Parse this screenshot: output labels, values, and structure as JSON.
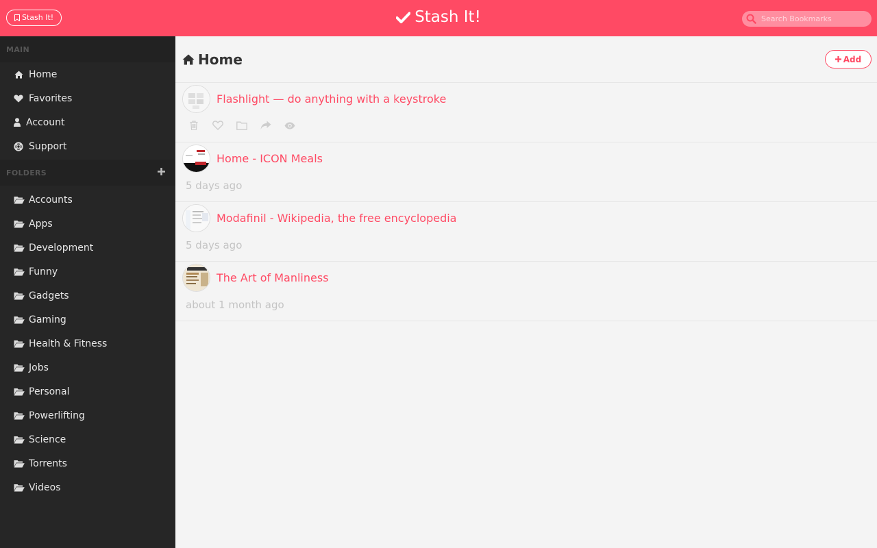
{
  "header": {
    "stash_button_label": "Stash It!",
    "brand_title": "Stash It!",
    "search_placeholder": "Search Bookmarks"
  },
  "sidebar": {
    "main_heading": "MAIN",
    "main_items": [
      {
        "label": "Home",
        "icon": "home-icon"
      },
      {
        "label": "Favorites",
        "icon": "heart-icon"
      },
      {
        "label": "Account",
        "icon": "user-icon"
      },
      {
        "label": "Support",
        "icon": "life-ring-icon"
      }
    ],
    "folders_heading": "FOLDERS",
    "folders": [
      {
        "label": "Accounts"
      },
      {
        "label": "Apps"
      },
      {
        "label": "Development"
      },
      {
        "label": "Funny"
      },
      {
        "label": "Gadgets"
      },
      {
        "label": "Gaming"
      },
      {
        "label": "Health & Fitness"
      },
      {
        "label": "Jobs"
      },
      {
        "label": "Personal"
      },
      {
        "label": "Powerlifting"
      },
      {
        "label": "Science"
      },
      {
        "label": "Torrents"
      },
      {
        "label": "Videos"
      }
    ]
  },
  "main": {
    "title": "Home",
    "add_label": "Add",
    "bookmarks": [
      {
        "title": "Flashlight — do anything with a keystroke",
        "time": "",
        "show_actions": true
      },
      {
        "title": "Home - ICON Meals",
        "time": "5 days ago",
        "show_actions": false
      },
      {
        "title": "Modafinil - Wikipedia, the free encyclopedia",
        "time": "5 days ago",
        "show_actions": false
      },
      {
        "title": "The Art of Manliness",
        "time": "about 1 month ago",
        "show_actions": false
      }
    ]
  },
  "colors": {
    "accent": "#ff4a64",
    "sidebar_bg": "#262626",
    "muted_text": "#c4c4c4"
  }
}
